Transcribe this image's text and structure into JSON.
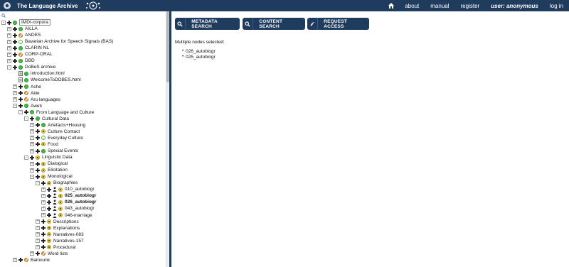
{
  "topbar": {
    "brand": "The Language Archive",
    "nav": [
      "about",
      "manual",
      "register"
    ],
    "user": "user: anonymous",
    "login": "log in"
  },
  "toolbar": {
    "metadata_search": "METADATA SEARCH",
    "content_search": "CONTENT SEARCH",
    "request_access": "REQUEST ACCESS"
  },
  "main": {
    "selected_heading": "Multiple nodes selected:",
    "selected_nodes": [
      "026_autobiogr",
      "025_autobiogr"
    ]
  },
  "tree": [
    {
      "label": "IMDI-corpora",
      "level": 0,
      "exp": "-",
      "icon": "green",
      "boxed": true
    },
    {
      "label": "AILLA",
      "level": 1,
      "exp": "+",
      "icon": "green"
    },
    {
      "label": "ANDES",
      "level": 1,
      "exp": "+",
      "icon": "orangeslash"
    },
    {
      "label": "Bavarian Archive for Speech Signals (BAS)",
      "level": 1,
      "exp": "+",
      "icon": "hollow"
    },
    {
      "label": "CLARIN NL",
      "level": 1,
      "exp": "+",
      "icon": "green"
    },
    {
      "label": "CORP-ORAL",
      "level": 1,
      "exp": "+",
      "icon": "orangeslash"
    },
    {
      "label": "DBD",
      "level": 1,
      "exp": "+",
      "icon": "green"
    },
    {
      "label": "DoBeS archive",
      "level": 1,
      "exp": "-",
      "icon": "green"
    },
    {
      "label": "introduction.html",
      "level": 2,
      "exp": "",
      "icon": "green",
      "doc": true
    },
    {
      "label": "WelcomeToDOBES.html",
      "level": 2,
      "exp": "",
      "icon": "green",
      "doc": true
    },
    {
      "label": "Aché",
      "level": 2,
      "exp": "+",
      "icon": "green"
    },
    {
      "label": "Akie",
      "level": 2,
      "exp": "+",
      "icon": "orangeslash"
    },
    {
      "label": "Aru languages",
      "level": 2,
      "exp": "+",
      "icon": "orangeslash"
    },
    {
      "label": "Aweti",
      "level": 2,
      "exp": "-",
      "icon": "green"
    },
    {
      "label": "From Language and Culture",
      "level": 3,
      "exp": "-",
      "icon": "green"
    },
    {
      "label": "Cultural Data",
      "level": 4,
      "exp": "-",
      "icon": "green"
    },
    {
      "label": "Artefacts+Housing",
      "level": 5,
      "exp": "+",
      "icon": "green"
    },
    {
      "label": "Culture Contact",
      "level": 5,
      "exp": "+",
      "icon": "yellowc"
    },
    {
      "label": "Everyday Culture",
      "level": 5,
      "exp": "+",
      "icon": "hollow"
    },
    {
      "label": "Food",
      "level": 5,
      "exp": "+",
      "icon": "yellowc"
    },
    {
      "label": "Special Events",
      "level": 5,
      "exp": "+",
      "icon": "green"
    },
    {
      "label": "Linguistic Data",
      "level": 4,
      "exp": "-",
      "icon": "yellowc"
    },
    {
      "label": "Dialogical",
      "level": 5,
      "exp": "+",
      "icon": "yellowc"
    },
    {
      "label": "Elicitation",
      "level": 5,
      "exp": "+",
      "icon": "yellowc"
    },
    {
      "label": "Monological",
      "level": 5,
      "exp": "-",
      "icon": "yellowc"
    },
    {
      "label": "Biographies",
      "level": 6,
      "exp": "-",
      "icon": "yellowc"
    },
    {
      "label": "010_autobiogr",
      "level": 7,
      "exp": "+",
      "icon": "yellowc",
      "person": true
    },
    {
      "label": "025_autobiogr",
      "level": 7,
      "exp": "+",
      "icon": "yellowc",
      "person": true,
      "bold": true
    },
    {
      "label": "026_autobiogr",
      "level": 7,
      "exp": "+",
      "icon": "yellowc",
      "person": true,
      "bold": true
    },
    {
      "label": "043_autobiogr",
      "level": 7,
      "exp": "+",
      "icon": "yellowc",
      "person": true
    },
    {
      "label": "046-marriage",
      "level": 7,
      "exp": "+",
      "icon": "yellowc",
      "person": true
    },
    {
      "label": "Descriptions",
      "level": 6,
      "exp": "+",
      "icon": "yellowc"
    },
    {
      "label": "Explanations",
      "level": 6,
      "exp": "+",
      "icon": "yellowc"
    },
    {
      "label": "Narratives-083",
      "level": 6,
      "exp": "+",
      "icon": "yellowc"
    },
    {
      "label": "Narratives-157",
      "level": 6,
      "exp": "+",
      "icon": "yellowc"
    },
    {
      "label": "Procedural",
      "level": 6,
      "exp": "+",
      "icon": "yellowc"
    },
    {
      "label": "Word lists",
      "level": 5,
      "exp": "+",
      "icon": "orangeslash"
    },
    {
      "label": "Bainounk",
      "level": 2,
      "exp": "+",
      "icon": "orangeslash"
    }
  ]
}
